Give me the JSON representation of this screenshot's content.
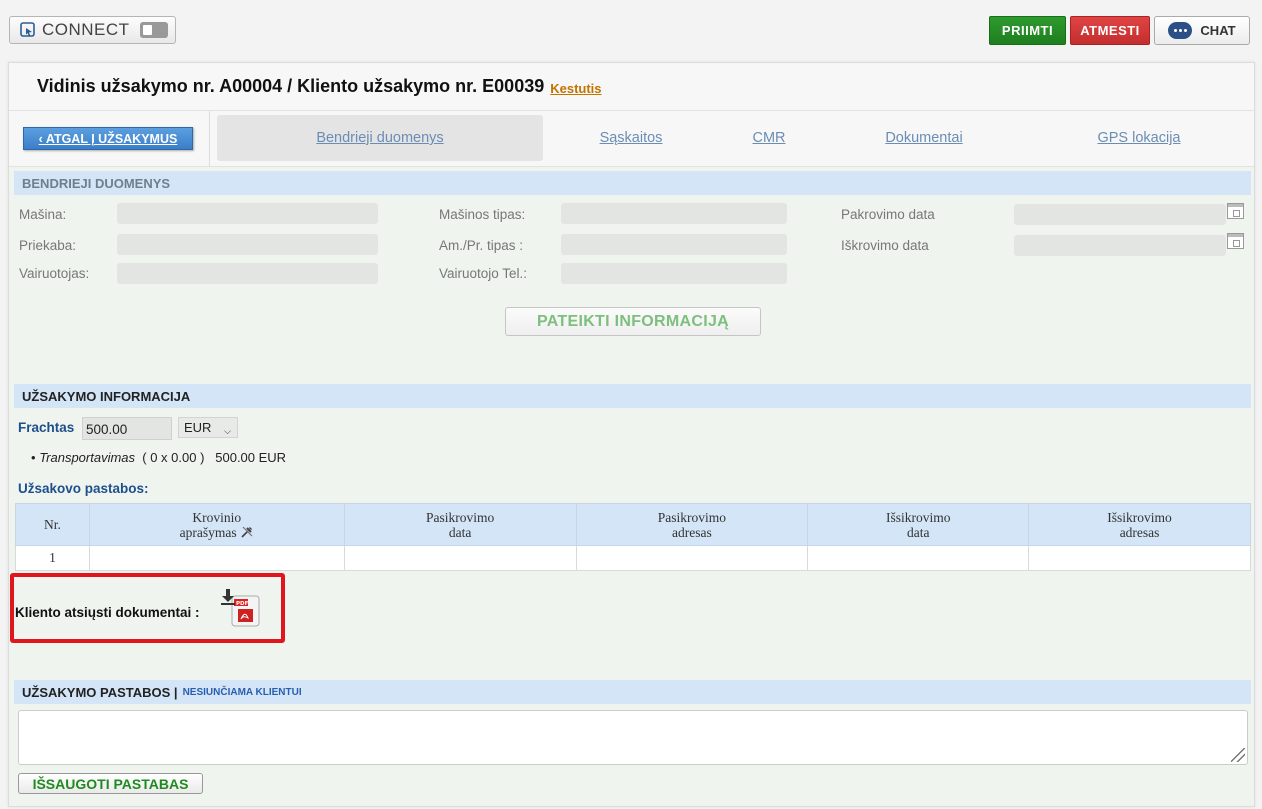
{
  "topbar": {
    "connect_label": "CONNECT",
    "accept_label": "PRIIMTI",
    "reject_label": "ATMESTI",
    "chat_label": "CHAT"
  },
  "header": {
    "title": "Vidinis užsakymo nr. A00004 / Kliento užsakymo nr. E00039",
    "user": "Kestutis"
  },
  "nav": {
    "back_label": "‹ ATGAL Į UŽSAKYMUS",
    "tabs": [
      "Bendrieji duomenys",
      "Sąskaitos",
      "CMR",
      "Dokumentai",
      "GPS lokacija"
    ],
    "active_tab": "Bendrieji duomenys"
  },
  "general": {
    "heading": "BENDRIEJI DUOMENYS",
    "fields": {
      "machine": "Mašina:",
      "trailer": "Priekaba:",
      "driver": "Vairuotojas:",
      "machine_type": "Mašinos tipas:",
      "am_pr_type": "Am./Pr. tipas :",
      "driver_phone": "Vairuotojo Tel.:",
      "loading_date": "Pakrovimo data",
      "unloading_date": "Iškrovimo data"
    },
    "submit_label": "PATEIKTI INFORMACIJĄ"
  },
  "order_info": {
    "heading": "UŽSAKYMO INFORMACIJA",
    "freight_label": "Frachtas",
    "freight_value": "500.00",
    "currency": "EUR",
    "transport_name": "Transportavimas",
    "transport_calc": "( 0 x 0.00 )",
    "transport_total": "500.00 EUR",
    "client_notes_label": "Užsakovo pastabos:"
  },
  "goods_table": {
    "headers": [
      [
        "Nr."
      ],
      [
        "Krovinio",
        "aprašymas"
      ],
      [
        "Pasikrovimo",
        "data"
      ],
      [
        "Pasikrovimo",
        "adresas"
      ],
      [
        "Išsikrovimo",
        "data"
      ],
      [
        "Išsikrovimo",
        "adresas"
      ]
    ],
    "rows": [
      [
        "1",
        "",
        "",
        "",
        "",
        ""
      ]
    ]
  },
  "documents": {
    "label": "Kliento atsiųsti dokumentai :",
    "pdf_badge": "PDF"
  },
  "order_notes": {
    "heading": "UŽSAKYMO PASTABOS |",
    "subheading": "NESIUNČIAMA KLIENTUI",
    "textarea_value": "",
    "save_label": "IŠSAUGOTI PASTABAS"
  },
  "colors": {
    "accept": "#1f7f1f",
    "reject": "#c52e2e",
    "section_bg": "#d3e5f6",
    "highlight": "#e0161f"
  }
}
